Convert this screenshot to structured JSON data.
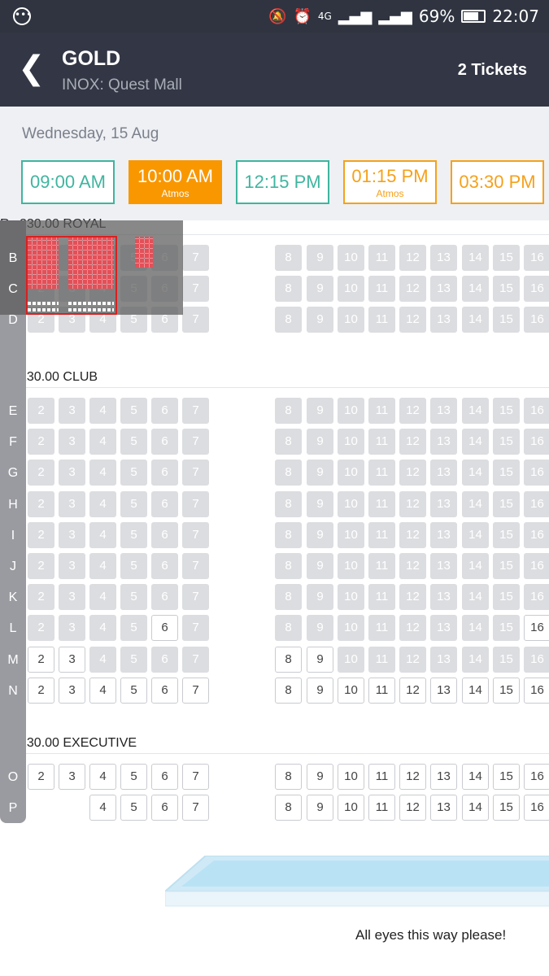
{
  "status": {
    "battery": "69%",
    "time": "22:07",
    "network": "4G"
  },
  "header": {
    "back_icon": "arrow-left-icon",
    "title": "GOLD",
    "subtitle": "INOX: Quest Mall",
    "tickets": "2 Tickets"
  },
  "date": "Wednesday, 15 Aug",
  "showtimes": [
    {
      "time": "09:00 AM",
      "tag": "",
      "style": "normal"
    },
    {
      "time": "10:00 AM",
      "tag": "Atmos",
      "style": "selected"
    },
    {
      "time": "12:15 PM",
      "tag": "",
      "style": "normal"
    },
    {
      "time": "01:15 PM",
      "tag": "Atmos",
      "style": "atmos"
    },
    {
      "time": "03:30 PM",
      "tag": "",
      "style": "atmos"
    }
  ],
  "sections": [
    {
      "label": "Rs.230.00 ROYAL",
      "rows": [
        {
          "row": "B",
          "available": []
        },
        {
          "row": "C",
          "available": []
        },
        {
          "row": "D",
          "available": []
        }
      ]
    },
    {
      "label": "Rs.230.00 CLUB",
      "rows": [
        {
          "row": "E",
          "available": []
        },
        {
          "row": "F",
          "available": []
        },
        {
          "row": "G",
          "available": []
        },
        {
          "row": "H",
          "available": []
        },
        {
          "row": "I",
          "available": []
        },
        {
          "row": "J",
          "available": []
        },
        {
          "row": "K",
          "available": []
        },
        {
          "row": "L",
          "available": [
            6,
            16
          ]
        },
        {
          "row": "M",
          "available": [
            2,
            3,
            8,
            9
          ]
        },
        {
          "row": "N",
          "available": [
            2,
            3,
            4,
            5,
            6,
            7,
            8,
            9,
            10,
            11,
            12,
            13,
            14,
            15,
            16
          ]
        }
      ]
    },
    {
      "label": "Rs.230.00 EXECUTIVE",
      "rows": [
        {
          "row": "O",
          "available": [
            2,
            3,
            4,
            5,
            6,
            7,
            8,
            9,
            10,
            11,
            12,
            13,
            14,
            15,
            16
          ]
        },
        {
          "row": "P",
          "available": [
            4,
            5,
            6,
            7,
            8,
            9,
            10,
            11,
            12,
            13,
            14,
            15,
            16
          ]
        }
      ]
    }
  ],
  "screen_note": "All eyes this way please!"
}
